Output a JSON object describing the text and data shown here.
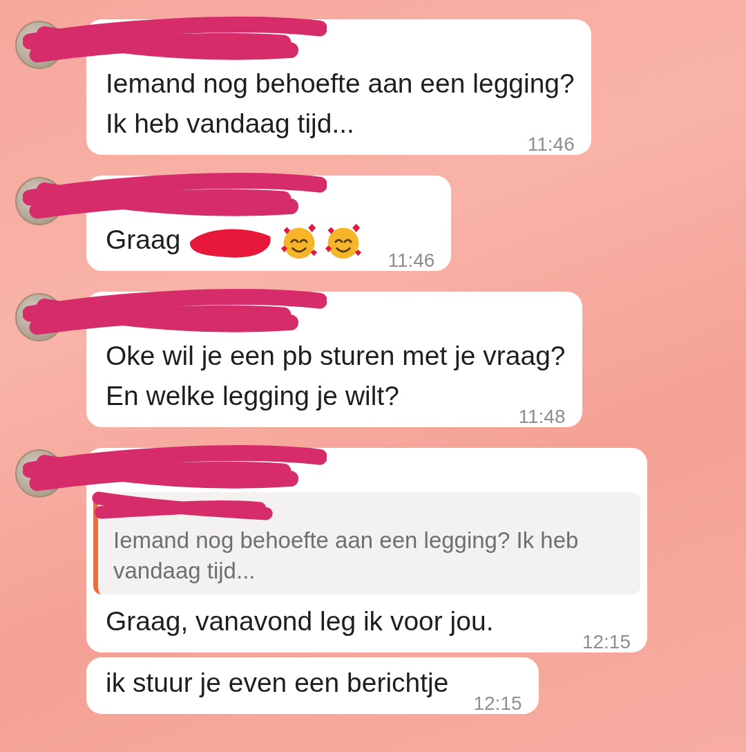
{
  "messages": [
    {
      "sender": {
        "redacted": true
      },
      "avatar": true,
      "parts": [
        {
          "kind": "text",
          "text": "Iemand nog behoefte aan een legging?\nIk heb vandaag tijd..."
        }
      ],
      "time": "11:46"
    },
    {
      "sender": {
        "redacted": true
      },
      "avatar": true,
      "parts": [
        {
          "kind": "text",
          "text": "Graag"
        },
        {
          "kind": "redacted"
        },
        {
          "kind": "emoji"
        },
        {
          "kind": "emoji"
        }
      ],
      "time": "11:46"
    },
    {
      "sender": {
        "redacted": true
      },
      "avatar": true,
      "parts": [
        {
          "kind": "text",
          "text": "Oke wil je een pb sturen met je vraag?\nEn welke legging je wilt?"
        }
      ],
      "time": "11:48"
    },
    {
      "sender": {
        "redacted": true
      },
      "avatar": true,
      "quote": {
        "sender": {
          "redacted": true
        },
        "text": "Iemand nog behoefte aan een legging? Ik heb vandaag tijd..."
      },
      "parts": [
        {
          "kind": "text",
          "text": "Graag, vanavond leg ik voor jou."
        }
      ],
      "time": "12:15"
    },
    {
      "avatar": false,
      "parts": [
        {
          "kind": "text",
          "text": "ik stuur je even een berichtje"
        }
      ],
      "time": "12:15"
    }
  ]
}
